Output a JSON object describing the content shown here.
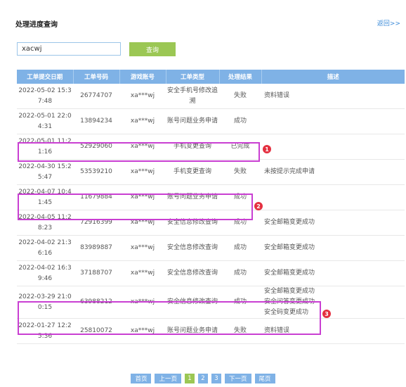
{
  "header": {
    "title": "处理进度查询",
    "back_label": "返回>>"
  },
  "search": {
    "value": "xacwj",
    "button_label": "查询"
  },
  "table": {
    "columns": [
      "工单提交日期",
      "工单号码",
      "游戏账号",
      "工单类型",
      "处理结果",
      "描述"
    ],
    "rows": [
      {
        "date": "2022-05-02 15:37:48",
        "order_no": "26774707",
        "account": "xa***wj",
        "type": "安全手机号修改追溯",
        "result": "失败",
        "desc": [
          "资料错误"
        ]
      },
      {
        "date": "2022-05-01 22:04:31",
        "order_no": "13894234",
        "account": "xa***wj",
        "type": "账号问题业务申请",
        "result": "成功",
        "desc": []
      },
      {
        "date": "2022-05-01 11:21:16",
        "order_no": "52929060",
        "account": "xa***wj",
        "type": "手机变更查询",
        "result": "已完成",
        "desc": []
      },
      {
        "date": "2022-04-30 15:25:47",
        "order_no": "53539210",
        "account": "xa***wj",
        "type": "手机变更查询",
        "result": "失败",
        "desc": [
          "未按提示完成申请"
        ]
      },
      {
        "date": "2022-04-07 10:41:45",
        "order_no": "11679884",
        "account": "xa***wj",
        "type": "账号问题业务申请",
        "result": "成功",
        "desc": []
      },
      {
        "date": "2022-04-05 11:28:23",
        "order_no": "72916399",
        "account": "xa***wj",
        "type": "安全信息修改查询",
        "result": "成功",
        "desc": [
          "安全邮箱变更成功"
        ]
      },
      {
        "date": "2022-04-02 21:36:16",
        "order_no": "83989887",
        "account": "xa***wj",
        "type": "安全信息修改查询",
        "result": "成功",
        "desc": [
          "安全邮箱变更成功"
        ]
      },
      {
        "date": "2022-04-02 16:39:46",
        "order_no": "37188707",
        "account": "xa***wj",
        "type": "安全信息修改查询",
        "result": "成功",
        "desc": [
          "安全邮箱变更成功"
        ]
      },
      {
        "date": "2022-03-29 21:00:15",
        "order_no": "63988212",
        "account": "xa***wj",
        "type": "安全信息修改查询",
        "result": "成功",
        "desc": [
          "安全邮箱变更成功",
          "安全问答变更成功",
          "安全码变更成功"
        ]
      },
      {
        "date": "2022-01-27 12:25:36",
        "order_no": "25810072",
        "account": "xa***wj",
        "type": "账号问题业务申请",
        "result": "失败",
        "desc": [
          "资料错误"
        ]
      }
    ]
  },
  "annotations": {
    "markers": [
      "1",
      "2",
      "3"
    ],
    "highlight_color": "#c93fd2",
    "marker_color": "#e43040"
  },
  "pagination": {
    "first": "首页",
    "prev": "上一页",
    "pages": [
      "1",
      "2",
      "3"
    ],
    "current": "1",
    "next": "下一页",
    "last": "尾页"
  },
  "colors": {
    "header_bg": "#7fb2e6",
    "button_green": "#9bc754",
    "link_blue": "#3a8ad8"
  }
}
